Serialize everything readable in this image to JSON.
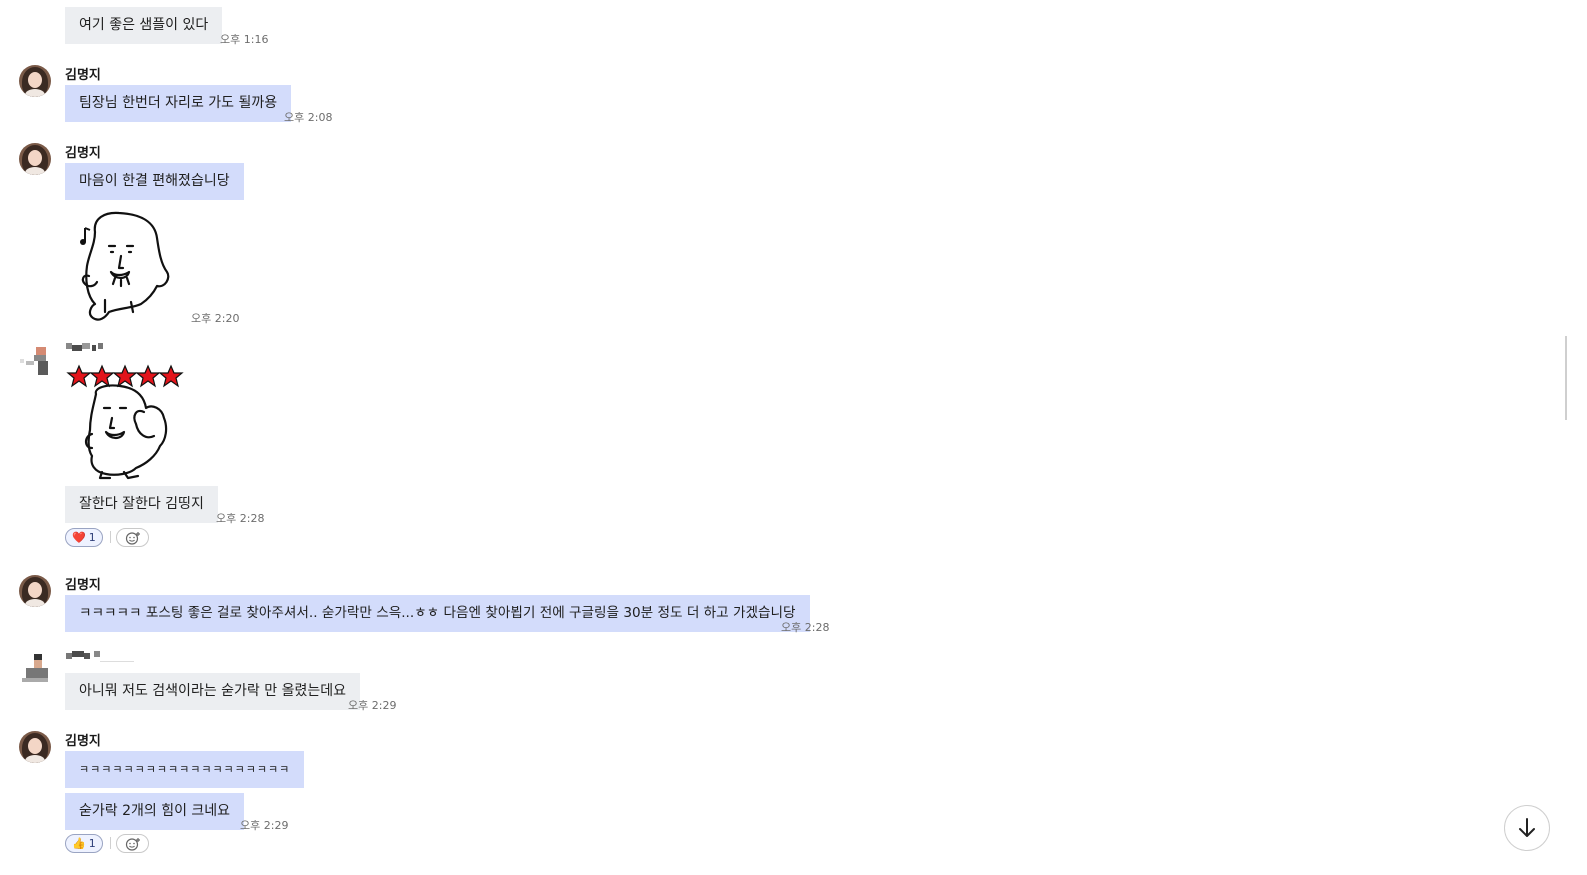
{
  "messages": {
    "m1": {
      "text": "여기 좋은 샘플이 있다",
      "time": "오후 1:16"
    },
    "m2": {
      "sender": "김명지",
      "text": "팀장님 한번더 자리로 가도 될까용",
      "time": "오후 2:08"
    },
    "m3": {
      "sender": "김명지",
      "text": "마음이 한결 편해졌습니당",
      "sticker_time": "오후 2:20"
    },
    "m4": {
      "text": "잘한다 잘한다 김띵지",
      "time": "오후 2:28",
      "reaction_emoji": "❤️",
      "reaction_count": "1"
    },
    "m5": {
      "sender": "김명지",
      "text": "ㅋㅋㅋㅋㅋ 포스팅 좋은 걸로 찾아주셔서.. 숟가락만 스윽...ㅎㅎ 다음엔 찾아뵙기 전에 구글링을 30분 정도 더 하고 가겠습니당",
      "time": "오후 2:28"
    },
    "m6": {
      "text": "아니뭐 저도 검색이라는 숟가락 만 올렸는데요",
      "time": "오후 2:29"
    },
    "m7": {
      "sender": "김명지",
      "text1": "ㅋㅋㅋㅋㅋㅋㅋㅋㅋㅋㅋㅋㅋㅋㅋㅋㅋㅋㅋ",
      "text2": "숟가락 2개의 힘이 크네요",
      "time": "오후 2:29",
      "reaction_emoji": "👍",
      "reaction_count": "1"
    }
  },
  "icons": {
    "scroll_down": "arrow-down-icon",
    "add_reaction": "smile-plus-icon"
  },
  "colors": {
    "my_bubble": "#d3dcfb",
    "other_bubble": "#eceef1",
    "star": "#e3141b"
  }
}
